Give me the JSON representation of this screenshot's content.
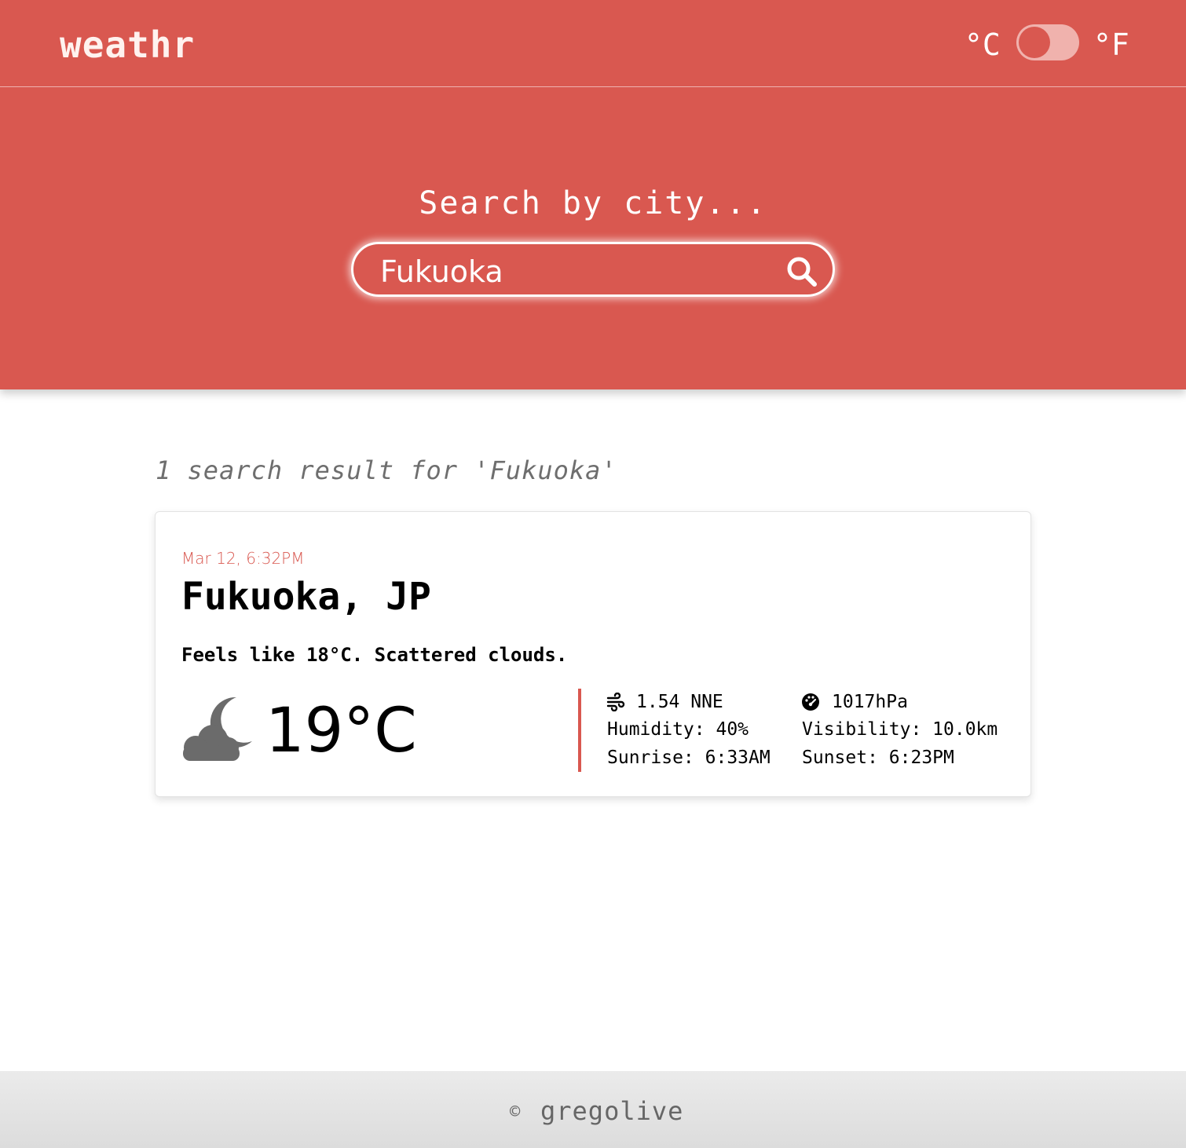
{
  "header": {
    "logo": "weathr",
    "unit_celsius": "°C",
    "unit_fahrenheit": "°F",
    "unit_toggle_state": "celsius"
  },
  "search": {
    "prompt": "Search by city...",
    "value": "Fukuoka"
  },
  "results": {
    "summary": "1 search result for 'Fukuoka'",
    "cards": [
      {
        "datetime": "Mar 12, 6:32PM",
        "location": "Fukuoka, JP",
        "description": "Feels like 18°C. Scattered clouds.",
        "temperature": "19°C",
        "weather_icon": "cloud-moon-icon",
        "wind": "1.54 NNE",
        "pressure": "1017hPa",
        "humidity": "Humidity: 40%",
        "visibility": "Visibility: 10.0km",
        "sunrise": "Sunrise: 6:33AM",
        "sunset": "Sunset: 6:23PM"
      }
    ]
  },
  "footer": {
    "copyright_symbol": "©",
    "author": "gregolive"
  },
  "colors": {
    "accent": "#d95850",
    "header_text": "#ffffff",
    "muted_text": "#6e6e6e",
    "icon_gray": "#6b6b6b"
  }
}
